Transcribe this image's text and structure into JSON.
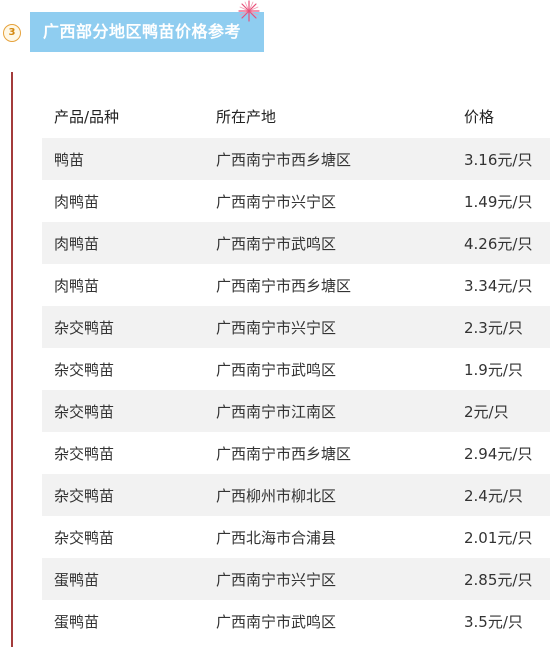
{
  "section": {
    "number": "3",
    "title": "广西部分地区鸭苗价格参考"
  },
  "table": {
    "headers": [
      "产品/品种",
      "所在产地",
      "价格"
    ],
    "rows": [
      [
        "鸭苗",
        "广西南宁市西乡塘区",
        "3.16元/只"
      ],
      [
        "肉鸭苗",
        "广西南宁市兴宁区",
        "1.49元/只"
      ],
      [
        "肉鸭苗",
        "广西南宁市武鸣区",
        "4.26元/只"
      ],
      [
        "肉鸭苗",
        "广西南宁市西乡塘区",
        "3.34元/只"
      ],
      [
        "杂交鸭苗",
        "广西南宁市兴宁区",
        "2.3元/只"
      ],
      [
        "杂交鸭苗",
        "广西南宁市武鸣区",
        "1.9元/只"
      ],
      [
        "杂交鸭苗",
        "广西南宁市江南区",
        "2元/只"
      ],
      [
        "杂交鸭苗",
        "广西南宁市西乡塘区",
        "2.94元/只"
      ],
      [
        "杂交鸭苗",
        "广西柳州市柳北区",
        "2.4元/只"
      ],
      [
        "杂交鸭苗",
        "广西北海市合浦县",
        "2.01元/只"
      ],
      [
        "蛋鸭苗",
        "广西南宁市兴宁区",
        "2.85元/只"
      ],
      [
        "蛋鸭苗",
        "广西南宁市武鸣区",
        "3.5元/只"
      ]
    ]
  },
  "colors": {
    "banner": "#8fcdf0",
    "divider": "#a33b3b",
    "row_shade": "#f2f2f2",
    "number_badge": "#e6a23c"
  }
}
